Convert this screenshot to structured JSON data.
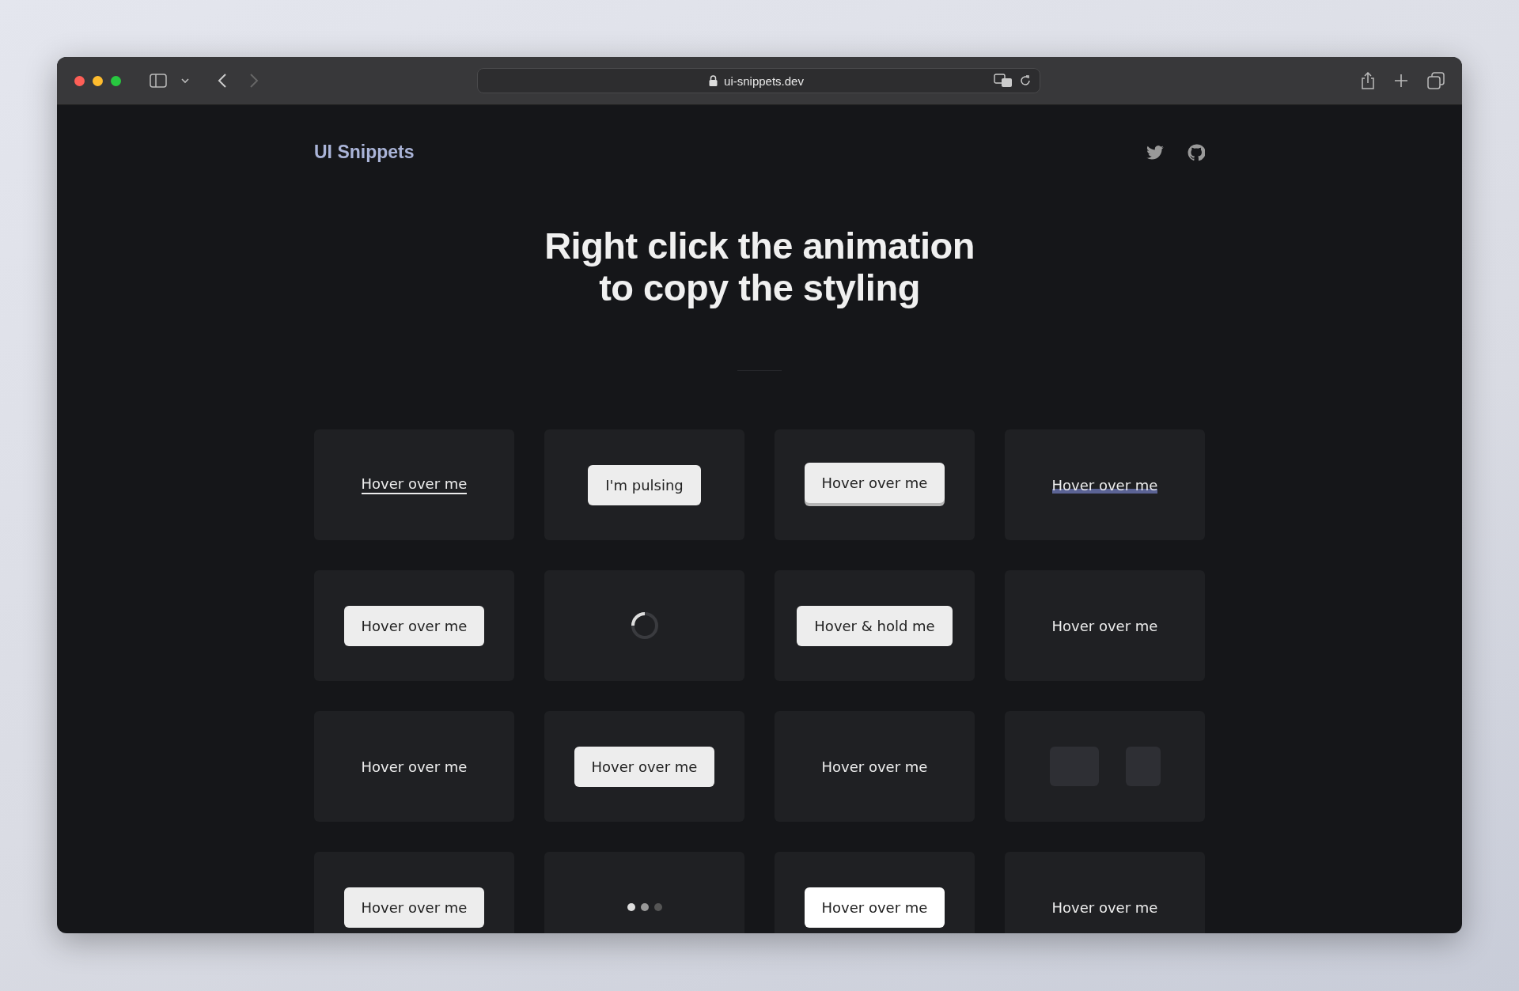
{
  "browser": {
    "url": "ui-snippets.dev"
  },
  "site": {
    "logo": "UI Snippets",
    "heading_lines": [
      "Right click the animation",
      "to copy the styling"
    ]
  },
  "cards": [
    {
      "kind": "underline",
      "label": "Hover over me"
    },
    {
      "kind": "button",
      "label": "I'm pulsing"
    },
    {
      "kind": "raised",
      "label": "Hover over me"
    },
    {
      "kind": "gradient-underline",
      "label": "Hover over me"
    },
    {
      "kind": "button",
      "label": "Hover over me"
    },
    {
      "kind": "spinner"
    },
    {
      "kind": "button",
      "label": "Hover & hold me"
    },
    {
      "kind": "text",
      "label": "Hover over me"
    },
    {
      "kind": "text",
      "label": "Hover over me"
    },
    {
      "kind": "button",
      "label": "Hover over me"
    },
    {
      "kind": "text",
      "label": "Hover over me"
    },
    {
      "kind": "skeleton"
    },
    {
      "kind": "button",
      "label": "Hover over me"
    },
    {
      "kind": "dots"
    },
    {
      "kind": "white-button",
      "label": "Hover over me"
    },
    {
      "kind": "text",
      "label": "Hover over me"
    }
  ]
}
